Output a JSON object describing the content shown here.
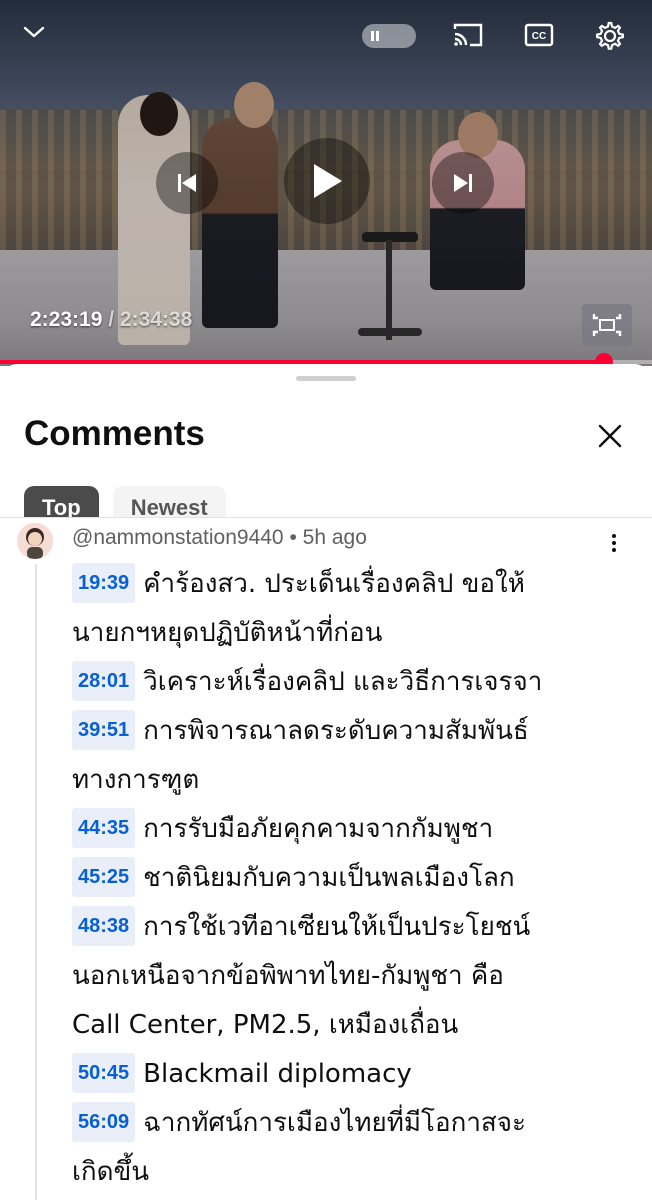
{
  "player": {
    "current_time": "2:23:19",
    "separator": " / ",
    "duration": "2:34:38",
    "progress_fraction": 0.926,
    "accent_color": "#ff0033",
    "icons": {
      "minimize": "chevron-down-icon",
      "autoplay": "autoplay-toggle-icon",
      "cast": "cast-icon",
      "captions": "closed-captions-icon",
      "settings": "gear-icon",
      "previous": "skip-previous-icon",
      "play": "play-icon",
      "next": "skip-next-icon",
      "fullscreen": "fullscreen-icon"
    },
    "cc_label": "CC"
  },
  "comments": {
    "title": "Comments",
    "chips": [
      {
        "label": "Top",
        "active": true
      },
      {
        "label": "Newest",
        "active": false
      }
    ],
    "items": [
      {
        "author": "@nammonstation9440",
        "dot": "•",
        "age": "5h ago",
        "lines": [
          {
            "ts": "19:39",
            "text": "คำร้องสว. ประเด็นเรื่องคลิป  ขอให้"
          },
          {
            "ts": "",
            "text": "นายกฯหยุดปฏิบัติหน้าที่ก่อน"
          },
          {
            "ts": "28:01",
            "text": "วิเคราะห์เรื่องคลิป และวิธีการเจรจา"
          },
          {
            "ts": "39:51",
            "text": "การพิจารณาลดระดับความสัมพันธ์"
          },
          {
            "ts": "",
            "text": "ทางการฑูต"
          },
          {
            "ts": "44:35",
            "text": "การรับมือภัยคุกคามจากกัมพูชา"
          },
          {
            "ts": "45:25",
            "text": "ชาตินิยมกับความเป็นพลเมืองโลก"
          },
          {
            "ts": "48:38",
            "text": "การใช้เวทีอาเซียนให้เป็นประโยชน์"
          },
          {
            "ts": "",
            "text": "นอกเหนือจากข้อพิพาทไทย-กัมพูชา คือ"
          },
          {
            "ts": "",
            "text": "Call Center, PM2.5, เหมืองเถื่อน"
          },
          {
            "ts": "50:45",
            "text": "Blackmail diplomacy"
          },
          {
            "ts": "56:09",
            "text": "ฉากทัศน์การเมืองไทยที่มีโอกาสจะ"
          },
          {
            "ts": "",
            "text": "เกิดขึ้น"
          }
        ]
      }
    ]
  }
}
